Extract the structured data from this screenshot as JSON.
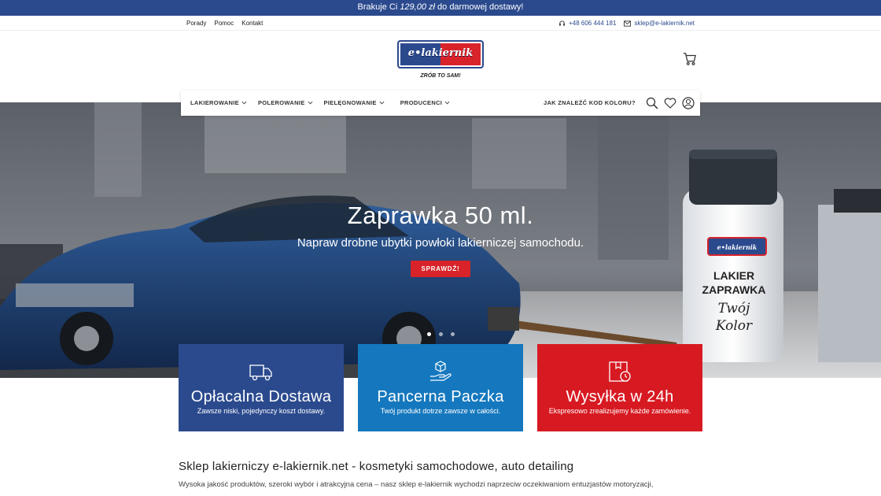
{
  "promo": {
    "prefix": "Brakuje Ci ",
    "amount": "129,00 zł",
    "suffix": " do darmowej dostawy!"
  },
  "top_links": {
    "left": [
      "Porady",
      "Pomoc",
      "Kontakt"
    ],
    "phone": "+48 606 444 181",
    "email": "sklep@e-lakiernik.net"
  },
  "logo": {
    "wordmark": "e•lakiernik",
    "tagline": "ZRÓB TO SAM!"
  },
  "nav": {
    "items": [
      "LAKIEROWANIE",
      "POLEROWANIE",
      "PIELĘGNOWANIE",
      "PRODUCENCI"
    ],
    "color_code_link": "JAK ZNALEŹĆ KOD KOLORU?"
  },
  "hero": {
    "title": "Zaprawka 50 ml.",
    "subtitle": "Napraw drobne ubytki powłoki lakierniczej samochodu.",
    "cta": "SPRAWDŹ!",
    "slides_count": 3,
    "active_slide": 1,
    "product_label": {
      "brand": "e•lakiernik",
      "line1": "LAKIER",
      "line2": "ZAPRAWKA",
      "script1": "Twój",
      "script2": "Kolor"
    }
  },
  "features": [
    {
      "title": "Opłacalna Dostawa",
      "subtitle": "Zawsze niski, pojedynczy koszt dostawy.",
      "icon": "delivery-truck-icon",
      "color": "#2b4a8e"
    },
    {
      "title": "Pancerna Paczka",
      "subtitle": "Twój produkt dotrze zawsze w całości.",
      "icon": "package-hand-icon",
      "color": "#1578be"
    },
    {
      "title": "Wysyłka w 24h",
      "subtitle": "Ekspresowo zrealizujemy każde zamówienie.",
      "icon": "shipping-clock-icon",
      "color": "#d71a22"
    }
  ],
  "about": {
    "heading": "Sklep lakierniczy e-lakiernik.net - kosmetyki samochodowe, auto detailing",
    "text": "Wysoka jakość produktów, szeroki wybór i atrakcyjna cena – nasz sklep e-lakiernik wychodzi naprzeciw oczekiwaniom entuzjastów motoryzacji,"
  },
  "colors": {
    "brand_blue": "#2b4a8e",
    "brand_red": "#d8232a",
    "light_blue": "#1578be"
  }
}
